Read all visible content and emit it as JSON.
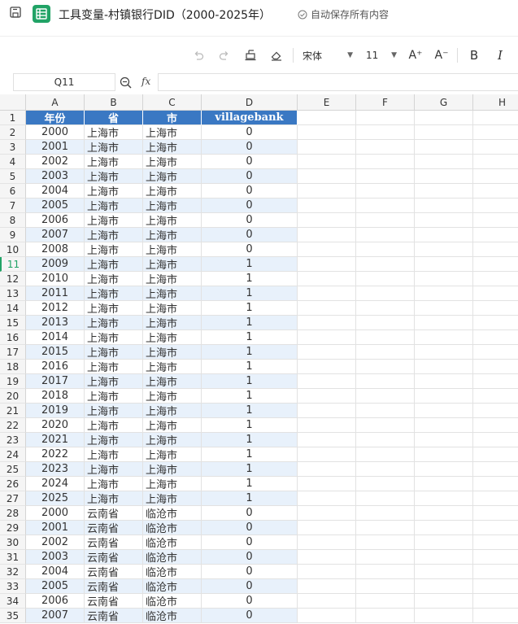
{
  "title_bar": {
    "doc_title": "工具变量-村镇银行DID（2000-2025年）",
    "autosave_text": "自动保存所有内容"
  },
  "toolbar": {
    "font_name": "宋体",
    "font_size": "11",
    "increase_font_label": "A⁺",
    "decrease_font_label": "A⁻",
    "bold_label": "B",
    "italic_label": "I"
  },
  "formula_bar": {
    "cell_ref": "Q11",
    "fx_label": "fx",
    "formula_value": ""
  },
  "sheet": {
    "columns": [
      "A",
      "B",
      "C",
      "D",
      "E",
      "F",
      "G",
      "H"
    ],
    "headers": [
      "年份",
      "省",
      "市",
      "villagebank"
    ],
    "active_row": 11,
    "accent_color": "#21a366",
    "header_fill": "#3a78c3",
    "band_fill": "#e8f1fb",
    "rows": [
      [
        "2000",
        "上海市",
        "上海市",
        "0"
      ],
      [
        "2001",
        "上海市",
        "上海市",
        "0"
      ],
      [
        "2002",
        "上海市",
        "上海市",
        "0"
      ],
      [
        "2003",
        "上海市",
        "上海市",
        "0"
      ],
      [
        "2004",
        "上海市",
        "上海市",
        "0"
      ],
      [
        "2005",
        "上海市",
        "上海市",
        "0"
      ],
      [
        "2006",
        "上海市",
        "上海市",
        "0"
      ],
      [
        "2007",
        "上海市",
        "上海市",
        "0"
      ],
      [
        "2008",
        "上海市",
        "上海市",
        "0"
      ],
      [
        "2009",
        "上海市",
        "上海市",
        "1"
      ],
      [
        "2010",
        "上海市",
        "上海市",
        "1"
      ],
      [
        "2011",
        "上海市",
        "上海市",
        "1"
      ],
      [
        "2012",
        "上海市",
        "上海市",
        "1"
      ],
      [
        "2013",
        "上海市",
        "上海市",
        "1"
      ],
      [
        "2014",
        "上海市",
        "上海市",
        "1"
      ],
      [
        "2015",
        "上海市",
        "上海市",
        "1"
      ],
      [
        "2016",
        "上海市",
        "上海市",
        "1"
      ],
      [
        "2017",
        "上海市",
        "上海市",
        "1"
      ],
      [
        "2018",
        "上海市",
        "上海市",
        "1"
      ],
      [
        "2019",
        "上海市",
        "上海市",
        "1"
      ],
      [
        "2020",
        "上海市",
        "上海市",
        "1"
      ],
      [
        "2021",
        "上海市",
        "上海市",
        "1"
      ],
      [
        "2022",
        "上海市",
        "上海市",
        "1"
      ],
      [
        "2023",
        "上海市",
        "上海市",
        "1"
      ],
      [
        "2024",
        "上海市",
        "上海市",
        "1"
      ],
      [
        "2025",
        "上海市",
        "上海市",
        "1"
      ],
      [
        "2000",
        "云南省",
        "临沧市",
        "0"
      ],
      [
        "2001",
        "云南省",
        "临沧市",
        "0"
      ],
      [
        "2002",
        "云南省",
        "临沧市",
        "0"
      ],
      [
        "2003",
        "云南省",
        "临沧市",
        "0"
      ],
      [
        "2004",
        "云南省",
        "临沧市",
        "0"
      ],
      [
        "2005",
        "云南省",
        "临沧市",
        "0"
      ],
      [
        "2006",
        "云南省",
        "临沧市",
        "0"
      ],
      [
        "2007",
        "云南省",
        "临沧市",
        "0"
      ]
    ]
  }
}
